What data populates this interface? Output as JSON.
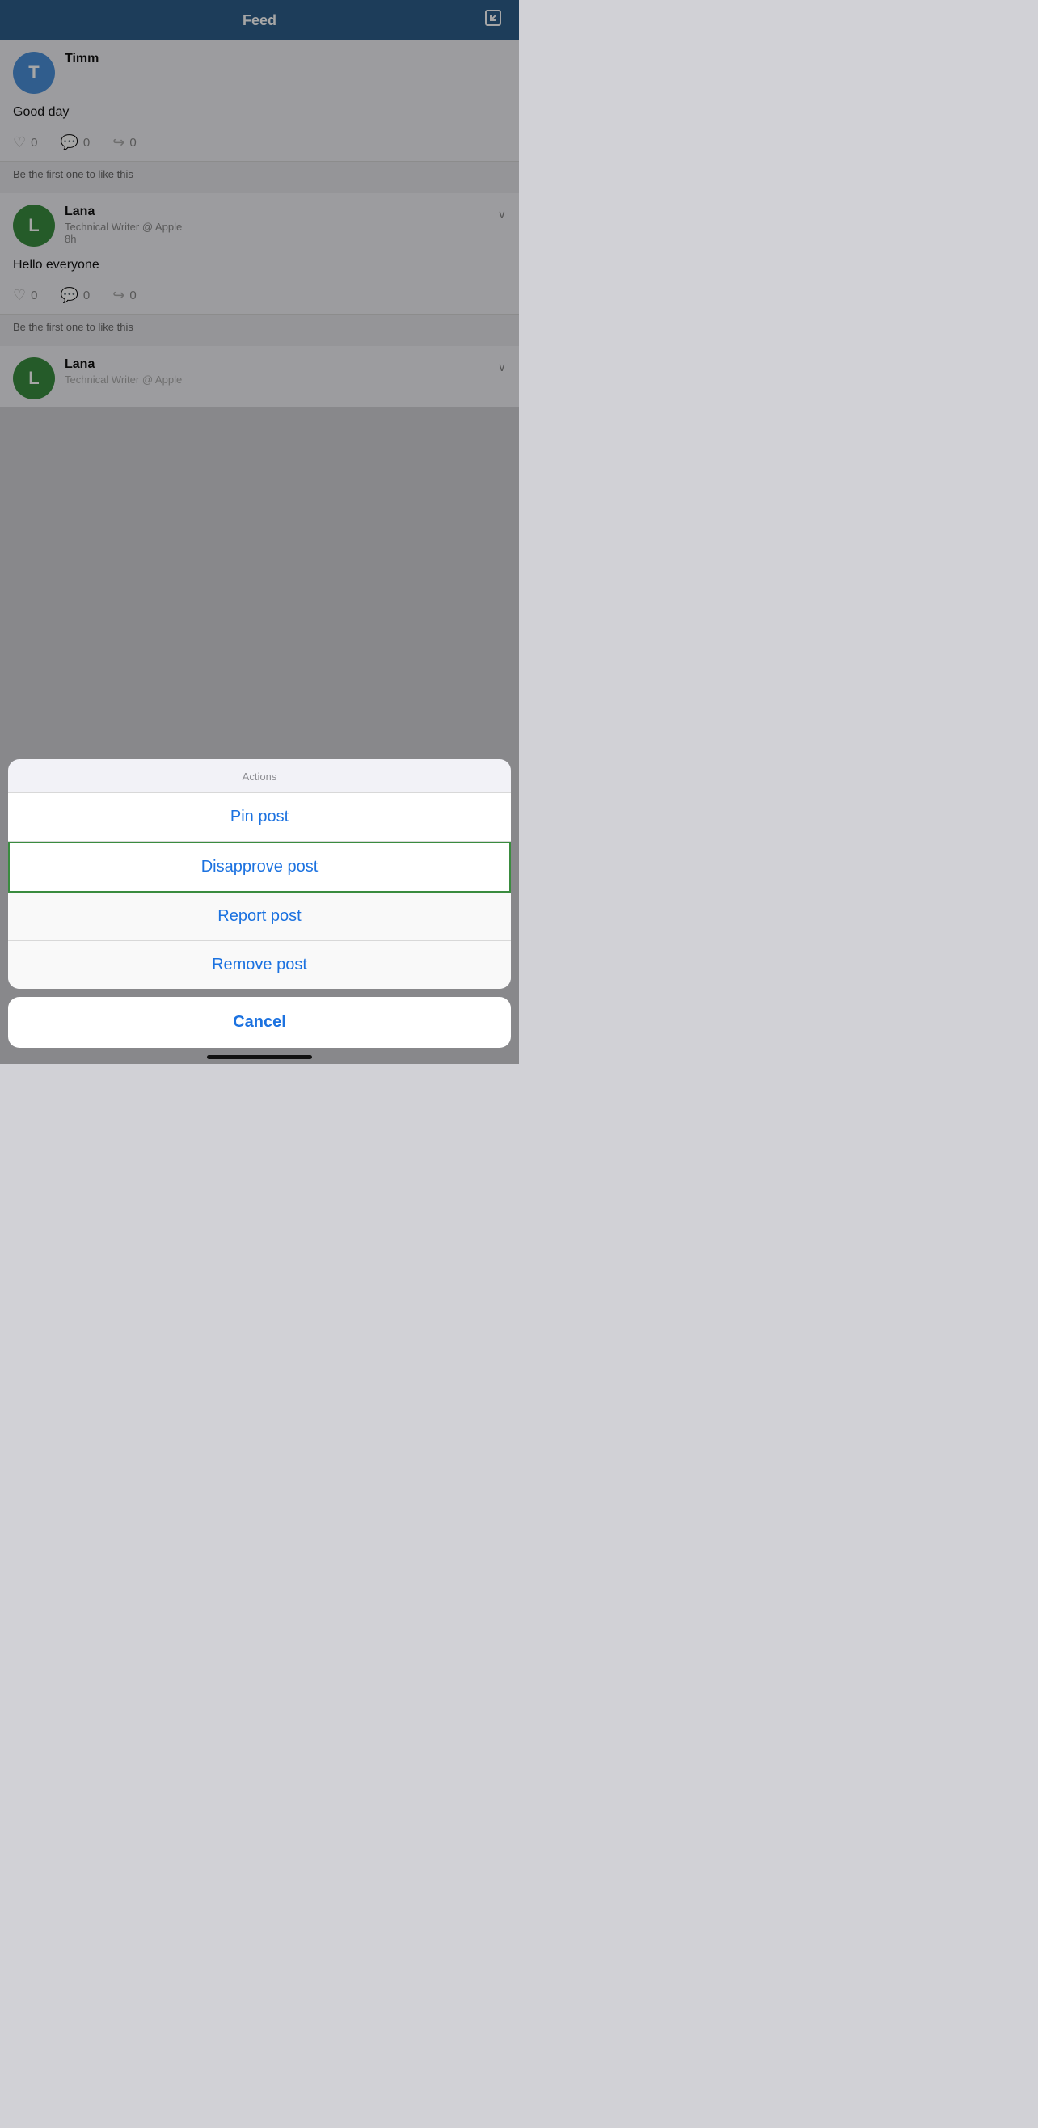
{
  "header": {
    "title": "Feed",
    "edit_icon": "✎"
  },
  "posts": [
    {
      "id": "post1",
      "avatar_letter": "T",
      "avatar_color": "blue",
      "user_name": "Timm",
      "user_sub": "",
      "time": "",
      "body": "Good day",
      "likes": "0",
      "comments": "0",
      "shares": "0",
      "footer": "Be the first one to like this",
      "show_chevron": false
    },
    {
      "id": "post2",
      "avatar_letter": "L",
      "avatar_color": "green",
      "user_name": "Lana",
      "user_sub": "Technical Writer @ Apple",
      "time": "8h",
      "body": "Hello everyone",
      "likes": "0",
      "comments": "0",
      "shares": "0",
      "footer": "Be the first one to like this",
      "show_chevron": true
    }
  ],
  "partial_post": {
    "avatar_letter": "L",
    "avatar_color": "green",
    "user_name": "Lana",
    "user_sub": "Technical Writer @ Apple",
    "show_chevron": true
  },
  "action_sheet": {
    "title": "Actions",
    "items": [
      {
        "label": "Pin post",
        "highlighted": false
      },
      {
        "label": "Disapprove post",
        "highlighted": true
      },
      {
        "label": "Report post",
        "highlighted": false
      },
      {
        "label": "Remove post",
        "highlighted": false
      }
    ],
    "cancel_label": "Cancel"
  },
  "icons": {
    "heart": "♡",
    "comment": "💬",
    "share": "↪",
    "chevron": "∨",
    "edit": "✎"
  }
}
